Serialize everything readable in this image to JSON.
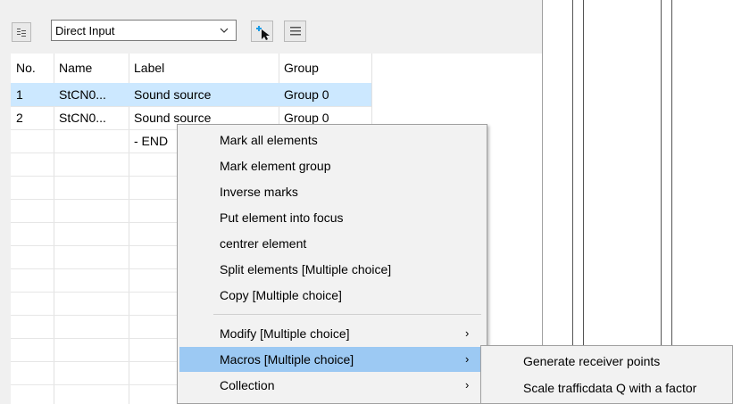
{
  "toolbar": {
    "list_icon": "list-view-icon",
    "source_select": "Direct Input",
    "add_icon": "add-pointer-icon",
    "menu_icon": "hamburger-icon"
  },
  "table": {
    "columns": [
      "No.",
      "Name",
      "Label",
      "Group"
    ],
    "rows": [
      {
        "no": "1",
        "name": "StCN0...",
        "label": "Sound source",
        "group": "Group 0"
      },
      {
        "no": "2",
        "name": "StCN0...",
        "label": "Sound source",
        "group": "Group 0"
      },
      {
        "no": "",
        "name": "",
        "label": "- END",
        "group": ""
      }
    ],
    "selection_color": "#cce8ff"
  },
  "context_menu": {
    "items": [
      "Mark all elements",
      "Mark element group",
      "Inverse marks",
      "Put element into focus",
      "centrer element",
      "Split elements [Multiple choice]",
      "Copy [Multiple choice]",
      "Modify [Multiple choice]",
      "Macros [Multiple choice]",
      "Collection"
    ],
    "highlight_color": "#9cc9f3"
  },
  "submenu": {
    "items": [
      "Generate receiver points",
      "Scale trafficdata Q with a factor"
    ]
  }
}
